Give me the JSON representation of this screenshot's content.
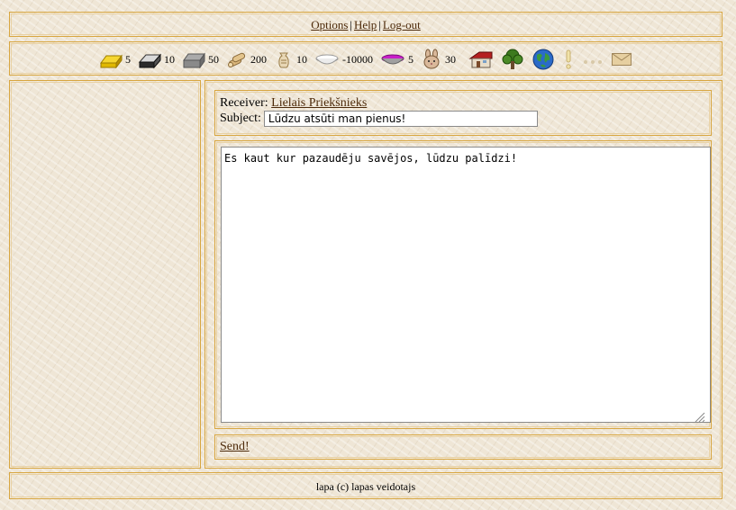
{
  "nav": {
    "options": "Options",
    "help": "Help",
    "logout": "Log-out",
    "separator": "|"
  },
  "resources": [
    {
      "icon": "gold-bar-icon",
      "value": "5"
    },
    {
      "icon": "iron-bar-icon",
      "value": "10"
    },
    {
      "icon": "stone-icon",
      "value": "50"
    },
    {
      "icon": "wood-logs-icon",
      "value": "200"
    },
    {
      "icon": "grain-sack-icon",
      "value": "10"
    },
    {
      "icon": "milk-bowl-icon",
      "value": "-10000"
    },
    {
      "icon": "berry-bowl-icon",
      "value": "5"
    },
    {
      "icon": "rabbit-icon",
      "value": "30"
    }
  ],
  "toolbar_icons": [
    "house-icon",
    "tree-icon",
    "globe-icon",
    "exclamation-icon",
    "ellipsis-icon",
    "mail-icon"
  ],
  "message": {
    "receiver_label": "Receiver:",
    "receiver_name": "Lielais Priekšnieks",
    "subject_label": "Subject:",
    "subject_value": "Lūdzu atsūti man pienus!",
    "body": "Es kaut kur pazaudēju savējos, lūdzu palīdzi!",
    "send_label": "Send!"
  },
  "footer": {
    "text": "lapa (c) lapas veidotajs"
  },
  "colors": {
    "border": "#d8a640",
    "link": "#4d2a0a",
    "background": "#efe6d6"
  }
}
